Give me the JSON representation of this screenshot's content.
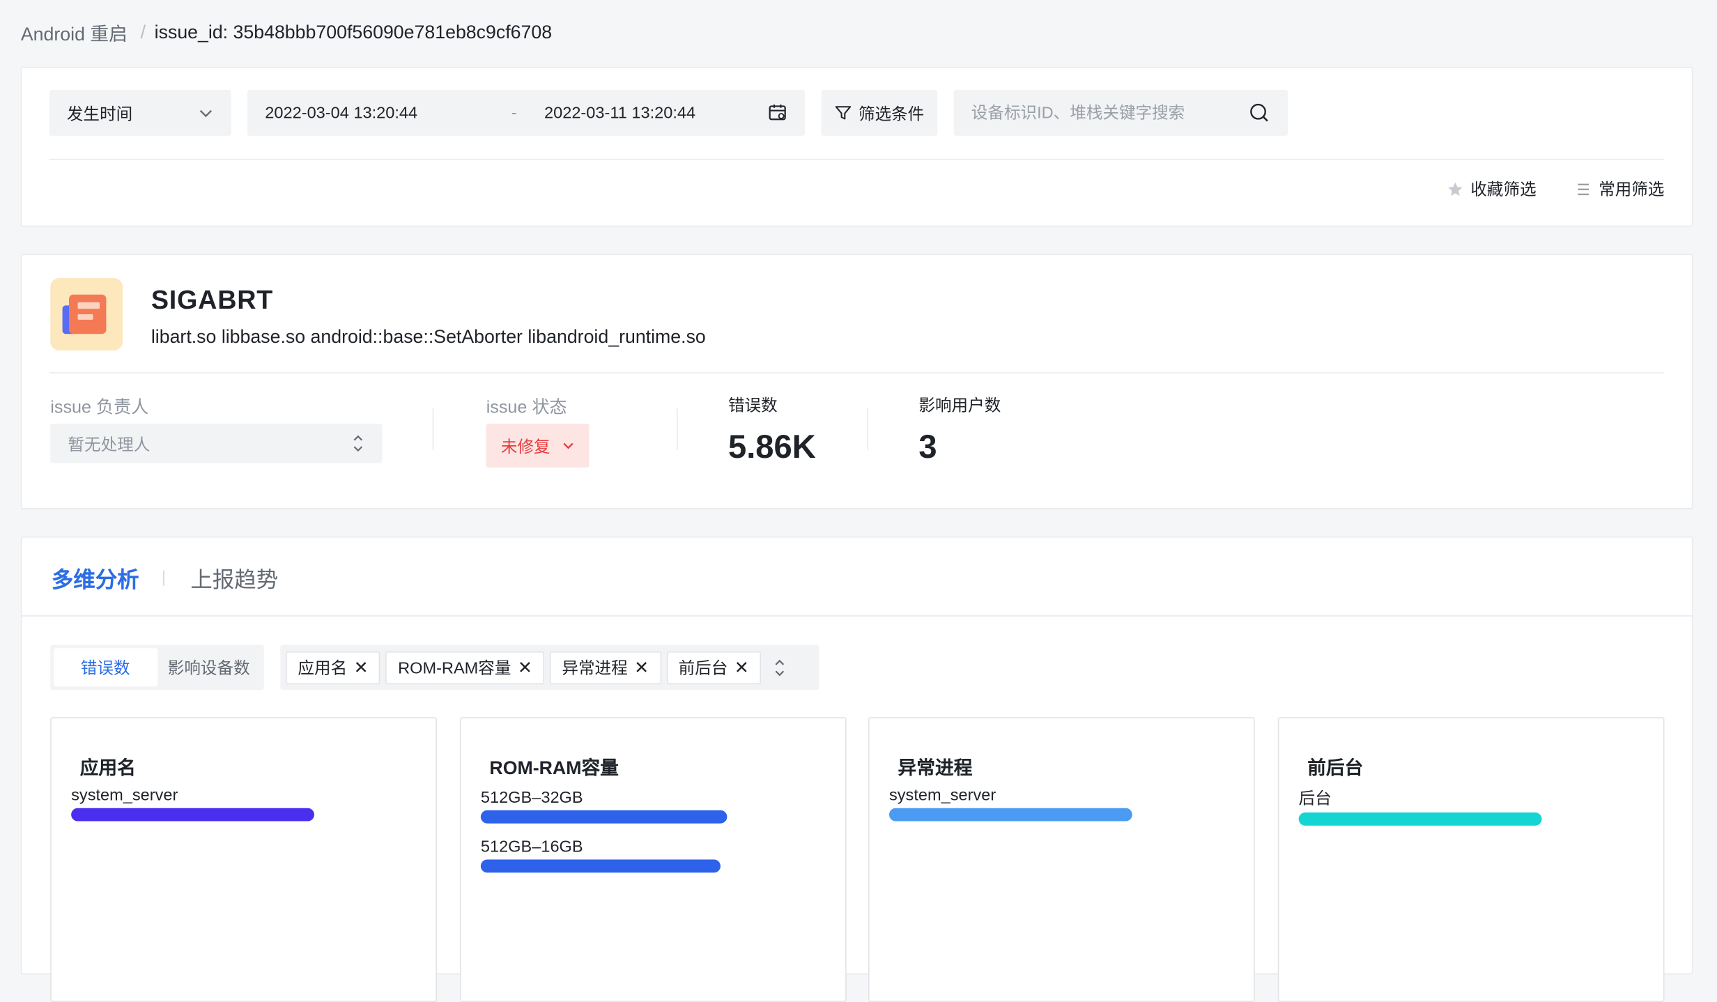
{
  "breadcrumb": {
    "root": "Android 重启",
    "sep": "/",
    "current": "issue_id: 35b48bbb700f56090e781eb8c9cf6708"
  },
  "filters": {
    "time_select": "发生时间",
    "date_start": "2022-03-04 13:20:44",
    "date_dash": "-",
    "date_end": "2022-03-11 13:20:44",
    "filter_button": "筛选条件",
    "search_placeholder": "设备标识ID、堆栈关键字搜索",
    "saved_filter": "收藏筛选",
    "common_filter": "常用筛选"
  },
  "issue": {
    "title": "SIGABRT",
    "subtitle": "libart.so libbase.so android::base::SetAborter libandroid_runtime.so",
    "assignee_label": "issue 负责人",
    "assignee_value": "暂无处理人",
    "status_label": "issue 状态",
    "status_value": "未修复",
    "errors_label": "错误数",
    "errors_value": "5.86K",
    "users_label": "影响用户数",
    "users_value": "3"
  },
  "analysis": {
    "tabs": [
      {
        "label": "多维分析",
        "active": true
      },
      {
        "label": "上报趋势",
        "active": false
      }
    ],
    "metric_options": [
      "错误数",
      "影响设备数"
    ],
    "dimension_tags": [
      "应用名",
      "ROM-RAM容量",
      "异常进程",
      "前后台"
    ],
    "cards": [
      {
        "title": "应用名",
        "rows": [
          {
            "label": "system_server",
            "fraction": 1.0,
            "color": "#4a2ff0"
          }
        ]
      },
      {
        "title": "ROM-RAM容量",
        "rows": [
          {
            "label": "512GB–32GB",
            "fraction": 1.0,
            "color": "#2e62ea"
          },
          {
            "label": "512GB–16GB",
            "fraction": 0.97,
            "color": "#2e62ea"
          }
        ]
      },
      {
        "title": "异常进程",
        "rows": [
          {
            "label": "system_server",
            "fraction": 1.0,
            "color": "#4c9bf2"
          }
        ]
      },
      {
        "title": "前后台",
        "rows": [
          {
            "label": "后台",
            "fraction": 1.0,
            "color": "#15d5d3"
          }
        ]
      }
    ]
  },
  "colors": {
    "accent": "#2b6de5",
    "status_red": "#e53e3e"
  }
}
